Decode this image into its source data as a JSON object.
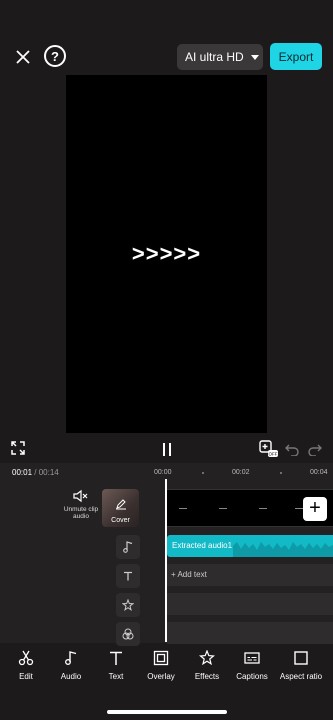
{
  "topbar": {
    "quality_label": "AI ultra HD",
    "export_label": "Export",
    "help_label": "?"
  },
  "preview": {
    "text": ">>>>>"
  },
  "timeline": {
    "current_time": "00:01",
    "separator": " / ",
    "total_time": "00:14",
    "ruler": [
      "00:00",
      "00:02",
      "00:04"
    ],
    "unmute_label": "Unmute clip audio",
    "cover_label": "Cover",
    "audio_clip_label": "Extracted audio1",
    "add_text_label": "+ Add text",
    "add_clip_label": "+"
  },
  "toolbar": {
    "items": [
      {
        "label": "Edit",
        "icon": "scissors-icon"
      },
      {
        "label": "Audio",
        "icon": "music-note-icon"
      },
      {
        "label": "Text",
        "icon": "text-icon"
      },
      {
        "label": "Overlay",
        "icon": "overlay-icon"
      },
      {
        "label": "Effects",
        "icon": "effects-icon"
      },
      {
        "label": "Captions",
        "icon": "captions-icon"
      },
      {
        "label": "Aspect ratio",
        "icon": "aspect-ratio-icon"
      }
    ]
  },
  "colors": {
    "accent": "#1fd4e5",
    "audio_track": "#12b9c6",
    "background": "#1c1a1b"
  }
}
